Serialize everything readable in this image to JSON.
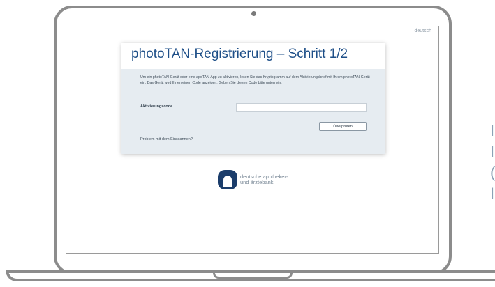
{
  "language_link": "deutsch",
  "card": {
    "title": "photoTAN-Registrierung – Schritt 1/2",
    "description": "Um ein photoTAN-Gerät oder eine apoTAN-App zu aktivieren, lesen Sie das Kryptogramm auf dem Aktivierungsbrief mit Ihrem photoTAN-Gerät ein. Das Gerät wird Ihnen einen Code anzeigen. Geben Sie diesen Code bitte unten ein.",
    "field_label": "Aktivierungscode",
    "field_value": "",
    "check_button": "Überprüfen",
    "problem_link": "Problem mit dem Einscannen?"
  },
  "brand": {
    "line1": "deutsche apotheker-",
    "line2": "und ärztebank",
    "logo_icon": "apobank-logo-icon",
    "logo_color": "#1b3d6b"
  },
  "side_text": [
    "I",
    "I",
    "(",
    "I"
  ],
  "colors": {
    "title": "#1e4f88",
    "card_background": "#e6ecf1",
    "frame": "#8c8c8c"
  }
}
